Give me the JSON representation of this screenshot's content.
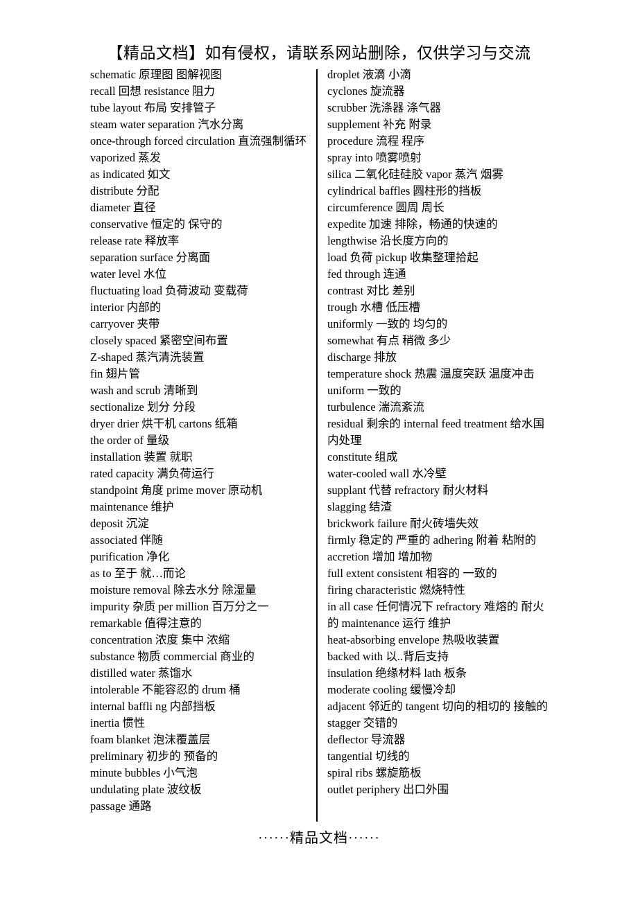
{
  "document": {
    "header": "【精品文档】如有侵权，请联系网站删除，仅供学习与交流",
    "footer": "······精品文档······",
    "left_column": [
      "schematic  原理图  图解视图",
      "recall  回想  resistance 阻力",
      "tube layout 布局  安排管子",
      "steam water separation 汽水分离",
      "once-through forced circulation 直流强制循环",
      "vaporized 蒸发",
      "as indicated  如文",
      "distribute  分配",
      "diameter  直径",
      "conservative 恒定的  保守的",
      "release rate 释放率",
      "separation surface  分离面",
      "water level 水位",
      "fluctuating load 负荷波动  变载荷",
      "interior  内部的",
      "carryover 夹带",
      "closely spaced  紧密空间布置",
      "Z-shaped  蒸汽清洗装置",
      "fin  翅片管",
      "wash and scrub 清晰到",
      "sectionalize  划分  分段",
      "dryer drier 烘干机  cartons 纸箱",
      "the order of  量级",
      "installation 装置  就职",
      "rated capacity  满负荷运行",
      "standpoint  角度 prime mover  原动机",
      "maintenance 维护",
      "deposit 沉淀",
      "associated  伴随",
      "purification  净化",
      "as to 至于  就…而论",
      "moisture removal 除去水分  除湿量",
      "impurity  杂质  per million  百万分之一",
      "remarkable  值得注意的",
      "concentration 浓度  集中  浓缩",
      "substance  物质 commercial 商业的",
      "distilled water  蒸馏水",
      "intolerable  不能容忍的 drum 桶",
      "internal baffli ng 内部挡板",
      "inertia 惯性",
      "foam blanket 泡沫覆盖层",
      "preliminary 初步的  预备的",
      "minute bubbles 小气泡",
      "undulating plate  波纹板",
      "passage  通路"
    ],
    "right_column": [
      "droplet 液滴  小滴",
      "cyclones  旋流器",
      "scrubber 洗涤器  涤气器",
      "supplement 补充  附录",
      "procedure 流程  程序",
      "spray into 喷雾喷射",
      "silica 二氧化硅硅胶 vapor 蒸汽  烟雾",
      "cylindrical baffles 圆柱形的挡板",
      "circumference 圆周  周长",
      "expedite  加速  排除，畅通的快速的",
      "lengthwise  沿长度方向的",
      "load 负荷  pickup 收集整理拾起",
      "fed through 连通",
      "contrast 对比  差别",
      "trough 水槽  低压槽",
      "uniformly 一致的  均匀的",
      "somewhat 有点  稍微  多少",
      "discharge 排放",
      "temperature shock 热震  温度突跃  温度冲击",
      "uniform 一致的",
      "turbulence 湍流紊流",
      "residual  剩余的 internal feed treatment 给水国内处理",
      "constitute  组成",
      "water-cooled wall 水冷壁",
      "supplant 代替  refractory 耐火材料",
      "slagging  结渣",
      "brickwork failure  耐火砖墙失效",
      "firmly 稳定的  严重的 adhering 附着  粘附的",
      "accretion 增加  增加物",
      "full extent consistent 相容的  一致的",
      "firing characteristic  燃烧特性",
      "in all case  任何情况下 refractory  难熔的  耐火的 maintenance  运行  维护",
      "heat-absorbing envelope 热吸收装置",
      "backed with 以..背后支持",
      "insulation 绝缘材料 lath 板条",
      "moderate cooling 缓慢冷却",
      "adjacent 邻近的 tangent 切向的相切的  接触的",
      "stagger 交错的",
      "deflector  导流器",
      "tangential  切线的",
      "spiral ribs 螺旋筋板",
      "outlet periphery 出口外围"
    ]
  }
}
